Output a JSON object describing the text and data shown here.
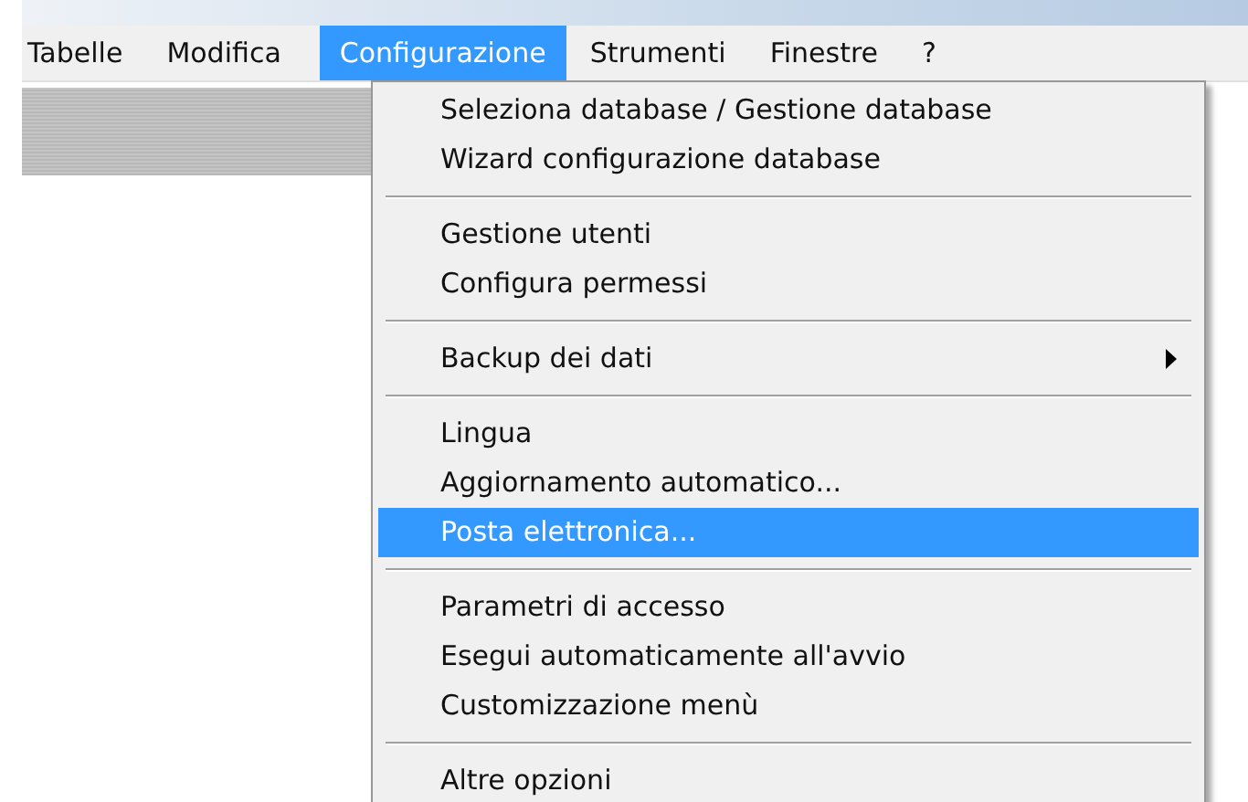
{
  "menubar": [
    {
      "label": "Tabelle",
      "selected": false
    },
    {
      "label": "Modifica",
      "selected": false
    },
    {
      "label": "Configurazione",
      "selected": true
    },
    {
      "label": "Strumenti",
      "selected": false
    },
    {
      "label": "Finestre",
      "selected": false
    },
    {
      "label": "?",
      "selected": false
    }
  ],
  "menu": {
    "sections": [
      {
        "items": [
          {
            "label": "Seleziona database / Gestione database",
            "selected": false,
            "submenu": false
          },
          {
            "label": "Wizard configurazione database",
            "selected": false,
            "submenu": false
          }
        ]
      },
      {
        "items": [
          {
            "label": "Gestione utenti",
            "selected": false,
            "submenu": false
          },
          {
            "label": "Configura permessi",
            "selected": false,
            "submenu": false
          }
        ]
      },
      {
        "items": [
          {
            "label": "Backup dei dati",
            "selected": false,
            "submenu": true
          }
        ]
      },
      {
        "items": [
          {
            "label": "Lingua",
            "selected": false,
            "submenu": false
          },
          {
            "label": "Aggiornamento automatico...",
            "selected": false,
            "submenu": false
          },
          {
            "label": "Posta elettronica...",
            "selected": true,
            "submenu": false
          }
        ]
      },
      {
        "items": [
          {
            "label": "Parametri di accesso",
            "selected": false,
            "submenu": false
          },
          {
            "label": "Esegui automaticamente all'avvio",
            "selected": false,
            "submenu": false
          },
          {
            "label": "Customizzazione menù",
            "selected": false,
            "submenu": false
          }
        ]
      },
      {
        "items": [
          {
            "label": "Altre opzioni",
            "selected": false,
            "submenu": false
          }
        ]
      }
    ]
  }
}
